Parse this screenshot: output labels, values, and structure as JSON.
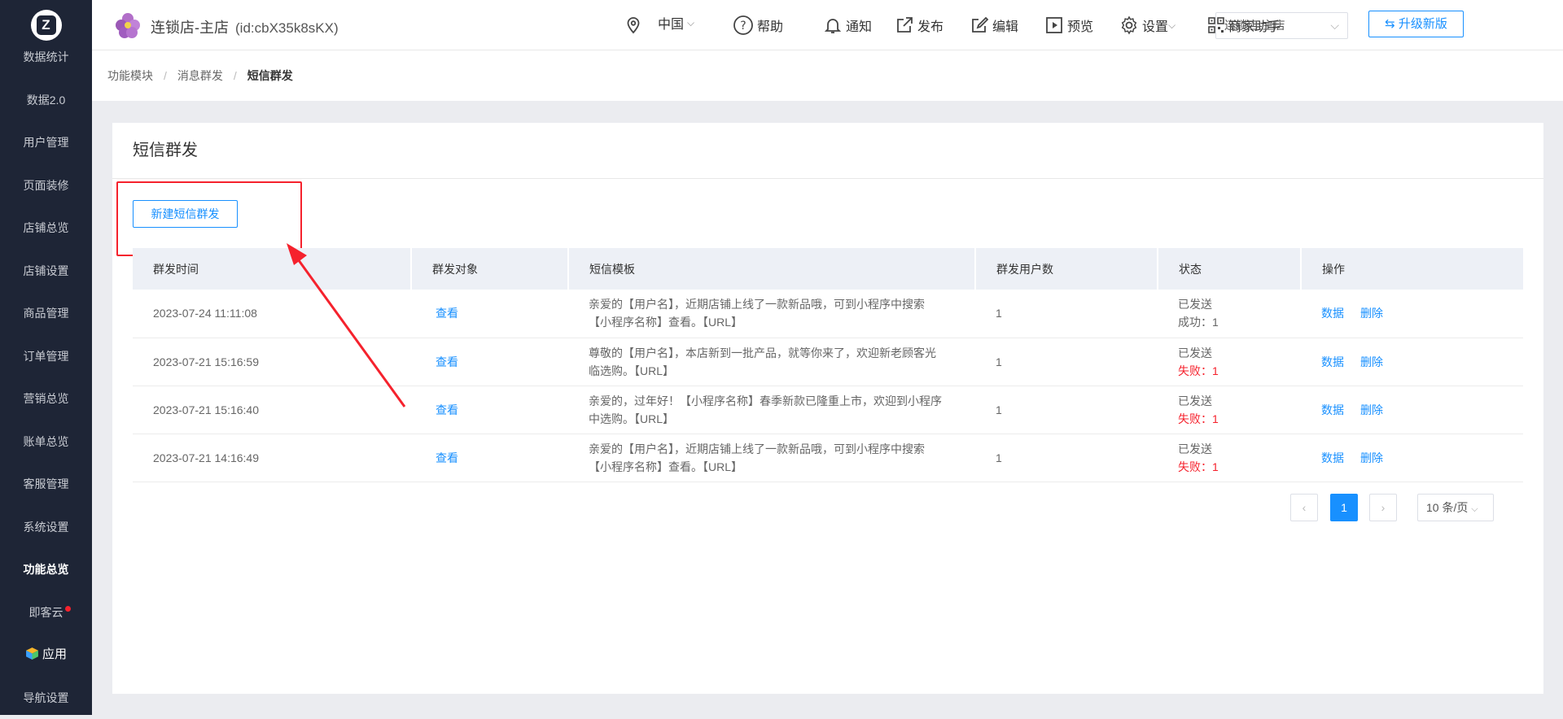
{
  "sidebar": {
    "items": [
      {
        "label": "数据统计"
      },
      {
        "label": "数据2.0"
      },
      {
        "label": "用户管理"
      },
      {
        "label": "页面装修"
      },
      {
        "label": "店铺总览"
      },
      {
        "label": "店铺设置"
      },
      {
        "label": "商品管理"
      },
      {
        "label": "订单管理"
      },
      {
        "label": "营销总览"
      },
      {
        "label": "账单总览"
      },
      {
        "label": "客服管理"
      },
      {
        "label": "系统设置"
      },
      {
        "label": "功能总览",
        "active": true
      },
      {
        "label": "即客云",
        "badge_dot": true
      },
      {
        "label": "应用"
      },
      {
        "label": "导航设置"
      }
    ]
  },
  "header": {
    "store_name": "连锁店-主店",
    "store_id": "(id:cbX35k8sKX)",
    "region": "中国",
    "help": "帮助",
    "notify": "通知",
    "publish": "发布",
    "edit": "编辑",
    "preview": "预览",
    "settings": "设置",
    "assistant": "商家助手",
    "store_select": "连锁店-主店",
    "upgrade": "升级新版"
  },
  "breadcrumb": {
    "items": [
      "功能模块",
      "消息群发",
      "短信群发"
    ]
  },
  "page": {
    "title": "短信群发",
    "new_button": "新建短信群发"
  },
  "table": {
    "headers": [
      "群发时间",
      "群发对象",
      "短信模板",
      "群发用户数",
      "状态",
      "操作"
    ],
    "rows": [
      {
        "time": "2023-07-24 11:11:08",
        "target": "查看",
        "template_line1": "亲爱的【用户名】，近期店铺上线了一款新品哦，可到小程序中搜索",
        "template_line2": "【小程序名称】查看。【URL】",
        "users": "1",
        "status": "已发送",
        "result": "成功：1",
        "result_type": "success",
        "op_data": "数据",
        "op_delete": "删除"
      },
      {
        "time": "2023-07-21 15:16:59",
        "target": "查看",
        "template_line1": "尊敬的【用户名】，本店新到一批产品，就等你来了，欢迎新老顾客光",
        "template_line2": "临选购。【URL】",
        "users": "1",
        "status": "已发送",
        "result": "失败：1",
        "result_type": "fail",
        "op_data": "数据",
        "op_delete": "删除"
      },
      {
        "time": "2023-07-21 15:16:40",
        "target": "查看",
        "template_line1": "亲爱的，过年好！【小程序名称】春季新款已隆重上市，欢迎到小程序",
        "template_line2": "中选购。【URL】",
        "users": "1",
        "status": "已发送",
        "result": "失败：1",
        "result_type": "fail",
        "op_data": "数据",
        "op_delete": "删除"
      },
      {
        "time": "2023-07-21 14:16:49",
        "target": "查看",
        "template_line1": "亲爱的【用户名】，近期店铺上线了一款新品哦，可到小程序中搜索",
        "template_line2": "【小程序名称】查看。【URL】",
        "users": "1",
        "status": "已发送",
        "result": "失败：1",
        "result_type": "fail",
        "op_data": "数据",
        "op_delete": "删除"
      }
    ]
  },
  "pagination": {
    "prev": "‹",
    "current": "1",
    "next": "›",
    "page_size": "10 条/页"
  },
  "colors": {
    "accent": "#1890ff",
    "sidebar_bg": "#1e2536",
    "annotation": "#f5222d"
  }
}
